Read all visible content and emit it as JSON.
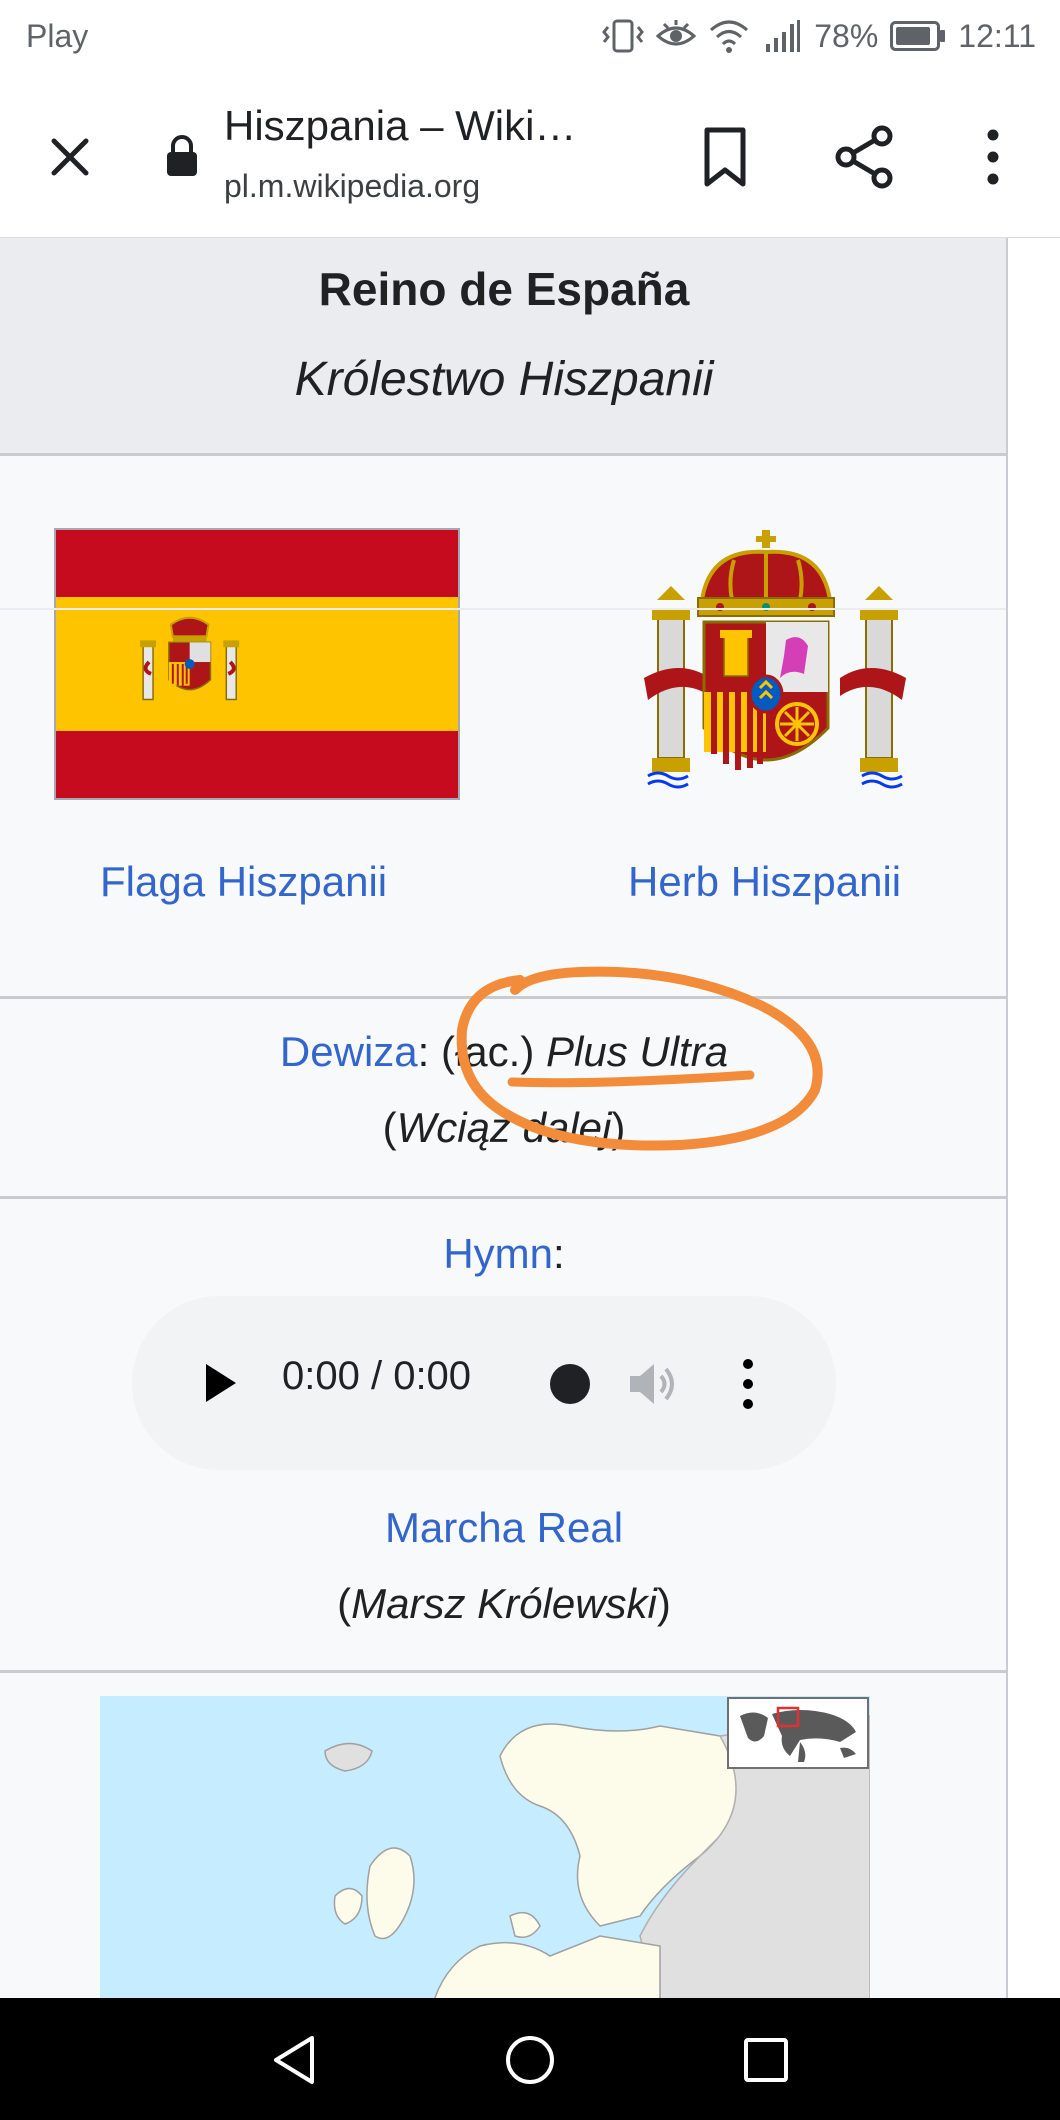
{
  "status_bar": {
    "carrier": "Play",
    "battery": "78%",
    "time": "12:11"
  },
  "browser": {
    "page_title": "Hiszpania – Wiki…",
    "url": "pl.m.wikipedia.org"
  },
  "infobox": {
    "official_name": "Reino de España",
    "polish_name": "Królestwo Hiszpanii",
    "flag_caption": "Flaga Hiszpanii",
    "coa_caption": "Herb Hiszpanii",
    "motto": {
      "label": "Dewiza",
      "colon": ":",
      "lang": "(łac.)",
      "text": "Plus Ultra",
      "translation": "Wciąż dalej"
    },
    "anthem": {
      "label": "Hymn",
      "colon": ":",
      "title": "Marcha Real",
      "translation": "Marsz Królewski"
    }
  },
  "audio_player": {
    "time": "0:00 / 0:00"
  },
  "colors": {
    "link": "#3366cc",
    "flag_red": "#c60b1e",
    "flag_yellow": "#ffc400",
    "annotation": "#f28c3a",
    "infobox_bg": "#f8f9fa",
    "header_bg": "#eaecf0"
  },
  "icons": [
    "close-icon",
    "lock-icon",
    "bookmark-icon",
    "share-icon",
    "more-vert-icon",
    "play-icon",
    "volume-icon",
    "back-icon",
    "home-icon",
    "recents-icon"
  ]
}
